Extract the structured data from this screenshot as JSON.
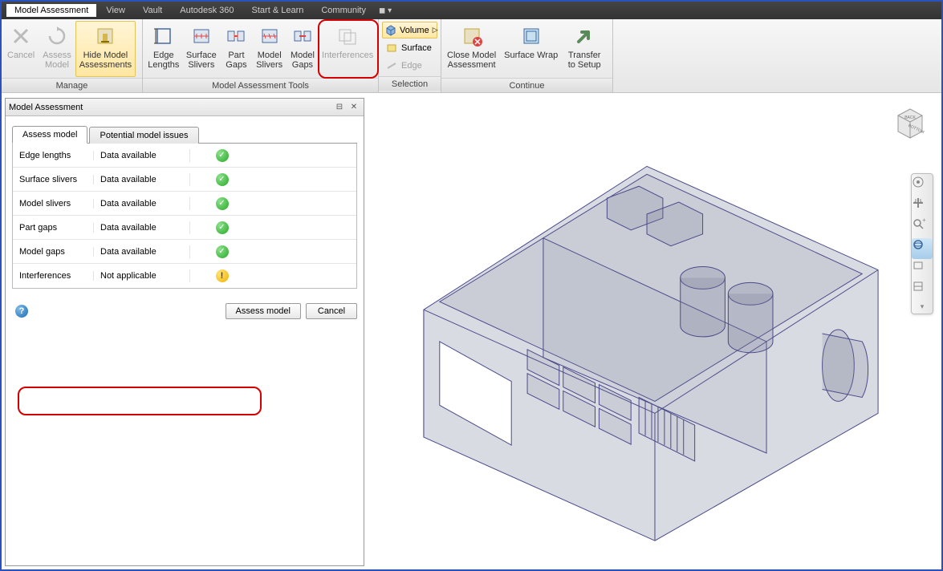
{
  "menubar": {
    "items": [
      {
        "label": "Model Assessment",
        "active": true
      },
      {
        "label": "View"
      },
      {
        "label": "Vault"
      },
      {
        "label": "Autodesk 360"
      },
      {
        "label": "Start & Learn"
      },
      {
        "label": "Community"
      }
    ]
  },
  "ribbon": {
    "groups": {
      "manage": {
        "label": "Manage",
        "buttons": [
          {
            "id": "cancel",
            "line1": "Cancel",
            "line2": "",
            "disabled": true
          },
          {
            "id": "assess-model",
            "line1": "Assess",
            "line2": "Model",
            "disabled": true
          },
          {
            "id": "hide-assessments",
            "line1": "Hide Model",
            "line2": "Assessments",
            "active": true
          }
        ]
      },
      "tools": {
        "label": "Model Assessment Tools",
        "buttons": [
          {
            "id": "edge-lengths",
            "line1": "Edge",
            "line2": "Lengths"
          },
          {
            "id": "surface-slivers",
            "line1": "Surface",
            "line2": "Slivers"
          },
          {
            "id": "part-gaps",
            "line1": "Part",
            "line2": "Gaps"
          },
          {
            "id": "model-slivers",
            "line1": "Model",
            "line2": "Slivers"
          },
          {
            "id": "model-gaps",
            "line1": "Model",
            "line2": "Gaps"
          },
          {
            "id": "interferences",
            "line1": "Interferences",
            "line2": "",
            "disabled": true
          }
        ]
      },
      "selection": {
        "label": "Selection",
        "items": [
          {
            "id": "volume",
            "label": "Volume",
            "active": true
          },
          {
            "id": "surface",
            "label": "Surface"
          },
          {
            "id": "edge",
            "label": "Edge",
            "disabled": true
          }
        ]
      },
      "continue": {
        "label": "Continue",
        "buttons": [
          {
            "id": "close-assessment",
            "line1": "Close Model",
            "line2": "Assessment"
          },
          {
            "id": "surface-wrap",
            "line1": "Surface Wrap",
            "line2": ""
          },
          {
            "id": "transfer-setup",
            "line1": "Transfer",
            "line2": "to Setup"
          }
        ]
      }
    }
  },
  "panel": {
    "title": "Model Assessment",
    "tabs": [
      {
        "id": "assess",
        "label": "Assess model",
        "active": true
      },
      {
        "id": "issues",
        "label": "Potential model issues"
      }
    ],
    "rows": [
      {
        "name": "Edge lengths",
        "status": "Data available",
        "icon": "ok"
      },
      {
        "name": "Surface slivers",
        "status": "Data available",
        "icon": "ok"
      },
      {
        "name": "Model slivers",
        "status": "Data available",
        "icon": "ok"
      },
      {
        "name": "Part gaps",
        "status": "Data available",
        "icon": "ok"
      },
      {
        "name": "Model gaps",
        "status": "Data available",
        "icon": "ok"
      },
      {
        "name": "Interferences",
        "status": "Not applicable",
        "icon": "warn"
      }
    ],
    "buttons": {
      "assess": "Assess model",
      "cancel": "Cancel"
    }
  },
  "viewcube": {
    "face": "BOTTOM",
    "side": "BACK"
  }
}
